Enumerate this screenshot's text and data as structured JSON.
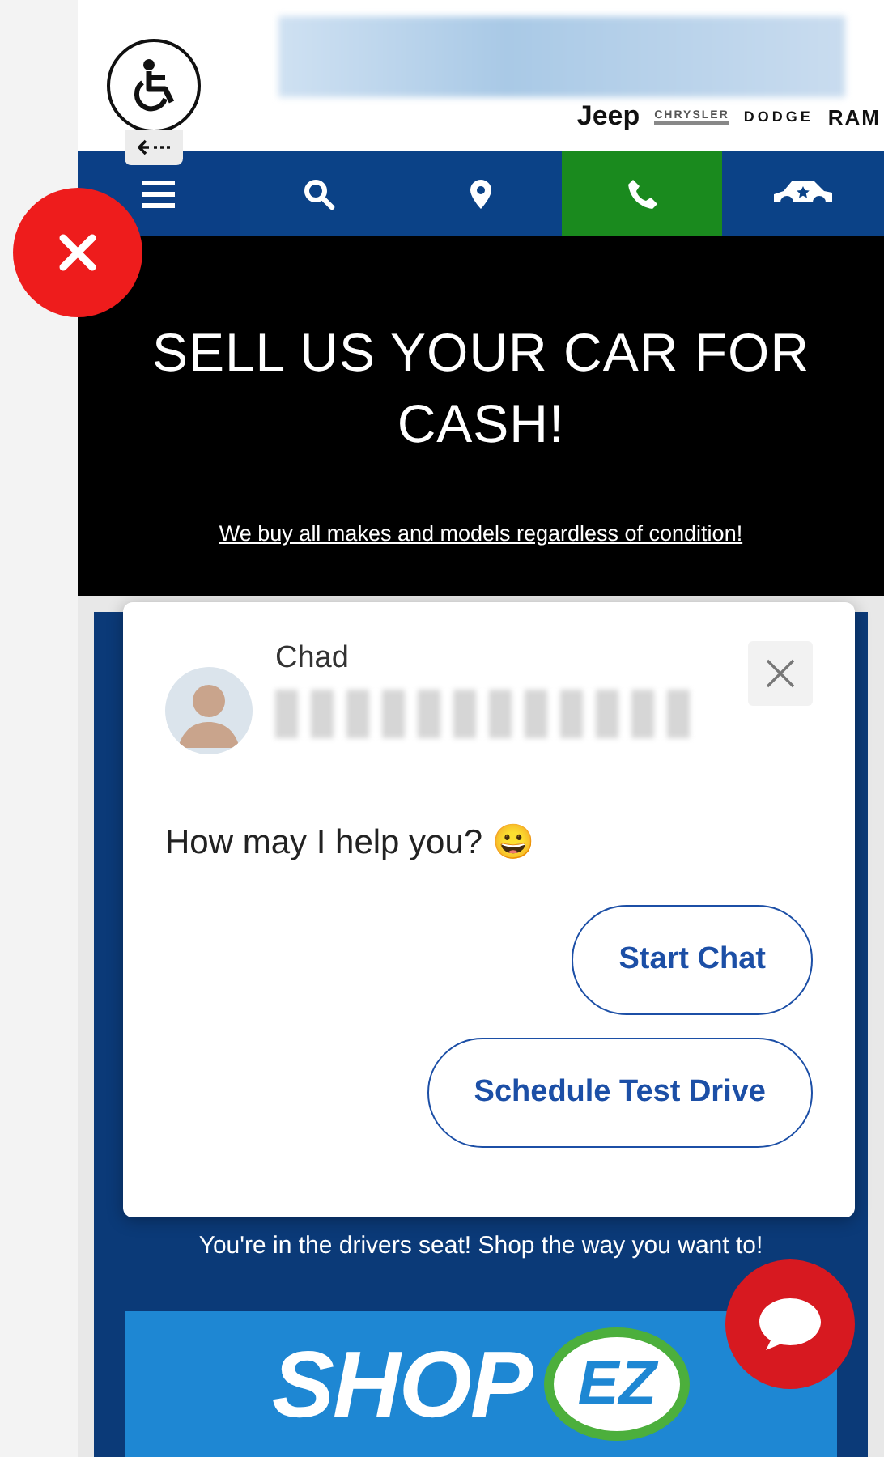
{
  "header": {
    "brands": [
      "Jeep",
      "CHRYSLER",
      "DODGE",
      "RAM"
    ]
  },
  "nav": {
    "items": [
      {
        "kind": "menu"
      },
      {
        "kind": "search"
      },
      {
        "kind": "location"
      },
      {
        "kind": "phone"
      },
      {
        "kind": "car"
      }
    ]
  },
  "hero": {
    "title": "SELL US YOUR CAR FOR CASH!",
    "link": "We buy all makes and models regardless of condition!"
  },
  "chat": {
    "agent": "Chad",
    "message": "How may I help you? 😀",
    "buttons": [
      "Start Chat",
      "Schedule Test Drive"
    ]
  },
  "promo": {
    "tagline": "You're in the drivers seat! Shop the way you want to!",
    "banner": {
      "word": "SHOP",
      "badge": "EZ"
    }
  }
}
